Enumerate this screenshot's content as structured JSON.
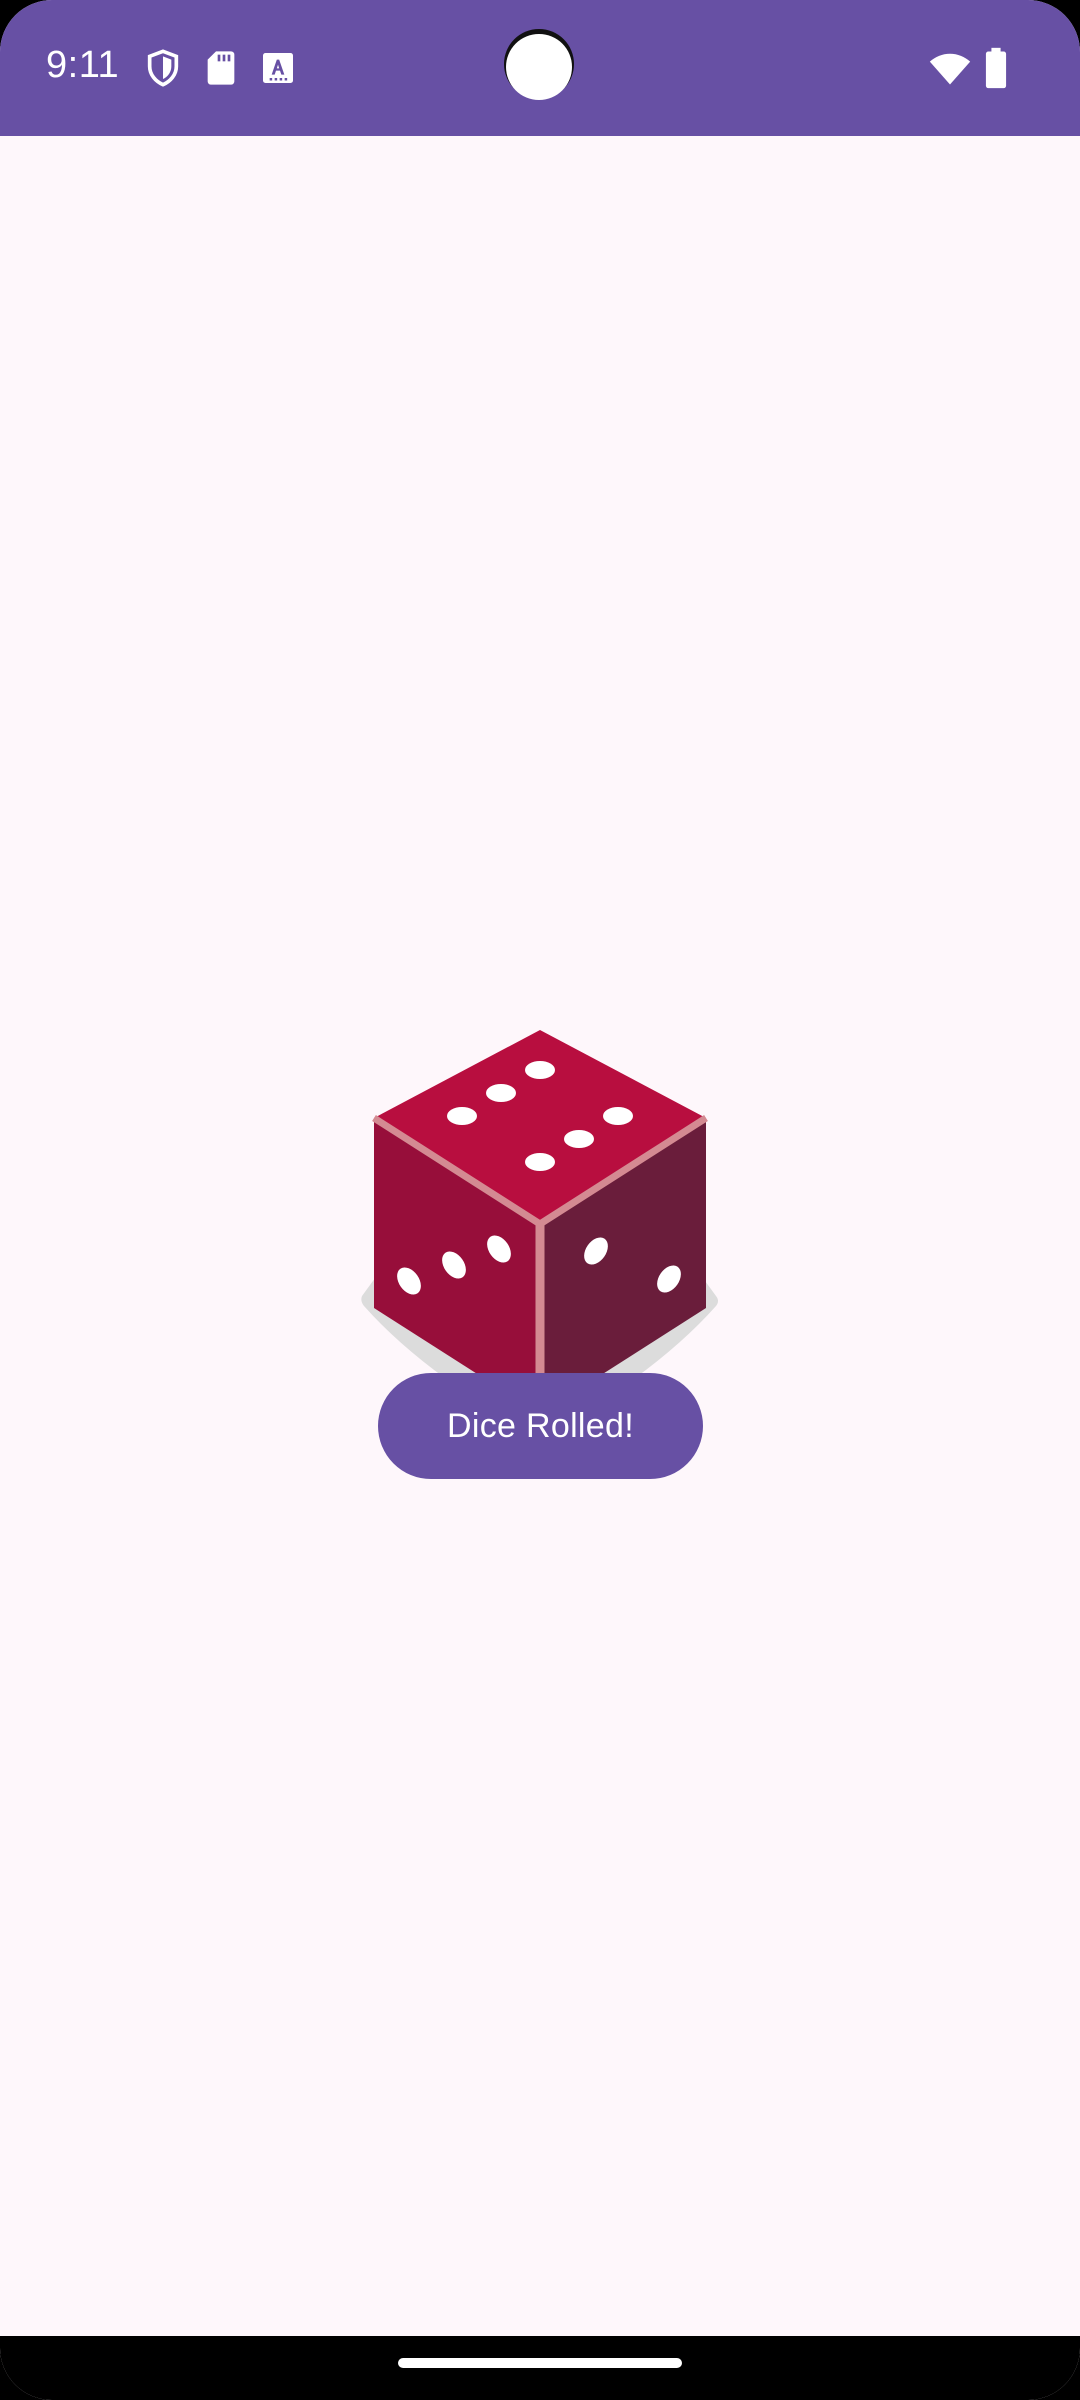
{
  "status_bar": {
    "time": "9:11",
    "icons_left": [
      "shield-icon",
      "sd-card-icon",
      "keyboard-a-icon"
    ],
    "icons_right": [
      "wifi-icon",
      "battery-icon"
    ],
    "color": "#6750a4"
  },
  "main": {
    "dice_image": {
      "icon": "dice-icon",
      "colors": {
        "top_face": "#b80e3f",
        "left_face": "#970e3a",
        "right_face": "#6a1d3b",
        "edges": "#d48a92",
        "pips": "#ffffff",
        "shadow": "#dcdcdc"
      }
    },
    "roll_button": {
      "label": "Dice Rolled!",
      "color": "#6750a4"
    }
  },
  "colors": {
    "background": "#fef7fb",
    "accent": "#6750a4"
  }
}
